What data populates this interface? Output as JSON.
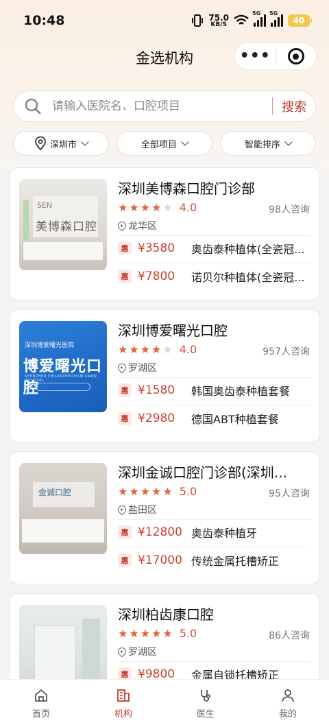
{
  "status_bar": {
    "time": "10:48",
    "speed_value": "75.0",
    "speed_unit": "KB/S",
    "sim1_label": "5G",
    "sim2_label": "5G",
    "battery": "40"
  },
  "header": {
    "title": "金选机构",
    "more_icon": "more-dots-icon",
    "close_icon": "target-icon"
  },
  "search": {
    "placeholder": "请输入医院名、口腔项目",
    "button_label": "搜索"
  },
  "filters": [
    {
      "label": "深圳市",
      "icon": "location-pin-icon"
    },
    {
      "label": "全部项目"
    },
    {
      "label": "智能排序"
    }
  ],
  "accent_color": "#c0392b",
  "clinics": [
    {
      "name": "深圳美博森口腔门诊部",
      "stars": 4,
      "score": "4.0",
      "consult": "98人咨询",
      "district": "龙华区",
      "thumb_sign": "美博森口腔",
      "thumb_logo": "SEN",
      "services": [
        {
          "badge": "惠",
          "price": "¥3580",
          "name": "奥齿泰种植体(全瓷冠..."
        },
        {
          "badge": "惠",
          "price": "¥7800",
          "name": "诺贝尔种植体(全瓷冠..."
        }
      ]
    },
    {
      "name": "深圳博爱曙光口腔",
      "stars": 4,
      "score": "4.0",
      "consult": "957人咨询",
      "district": "罗湖区",
      "thumb_line1": "深圳博爱曙光医院",
      "thumb_line2": "博爱曙光口腔",
      "thumb_line3": "SHENZHEN PHILANTHROPISM DAWN HOSPITAL",
      "services": [
        {
          "badge": "惠",
          "price": "¥1580",
          "name": "韩国奥齿泰种植套餐"
        },
        {
          "badge": "惠",
          "price": "¥2980",
          "name": "德国ABT种植套餐"
        }
      ]
    },
    {
      "name": "深圳金诚口腔门诊部(深圳...",
      "stars": 5,
      "score": "5.0",
      "consult": "95人咨询",
      "district": "盐田区",
      "thumb_logo": "金诚口腔",
      "services": [
        {
          "badge": "惠",
          "price": "¥12800",
          "name": "奥齿泰种植牙"
        },
        {
          "badge": "惠",
          "price": "¥17000",
          "name": "传统金属托槽矫正"
        }
      ]
    },
    {
      "name": "深圳柏齿康口腔",
      "stars": 5,
      "score": "5.0",
      "consult": "86人咨询",
      "district": "罗湖区",
      "services": [
        {
          "badge": "惠",
          "price": "¥9800",
          "name": "金属自锁托槽矫正"
        }
      ]
    }
  ],
  "tabbar": [
    {
      "label": "首页",
      "icon": "home-icon",
      "active": false
    },
    {
      "label": "机构",
      "icon": "institution-icon",
      "active": true
    },
    {
      "label": "医生",
      "icon": "stethoscope-icon",
      "active": false
    },
    {
      "label": "我的",
      "icon": "user-icon",
      "active": false
    }
  ]
}
